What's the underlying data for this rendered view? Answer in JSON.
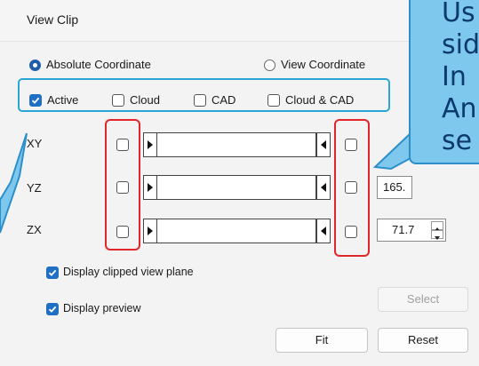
{
  "window": {
    "title": "View Clip"
  },
  "mode": {
    "absolute_label": "Absolute Coordinate",
    "view_label": "View Coordinate",
    "selected": "absolute"
  },
  "filters": {
    "active_label": "Active",
    "active_checked": true,
    "cloud_label": "Cloud",
    "cloud_checked": false,
    "cad_label": "CAD",
    "cad_checked": false,
    "cloud_cad_label": "Cloud & CAD",
    "cloud_cad_checked": false
  },
  "planes": [
    {
      "label": "XY",
      "value": ""
    },
    {
      "label": "YZ",
      "value": "165."
    },
    {
      "label": "ZX",
      "value": "71.7"
    }
  ],
  "options": {
    "display_clipped_label": "Display clipped view plane",
    "display_clipped_checked": true,
    "display_preview_label": "Display preview",
    "display_preview_checked": true
  },
  "buttons": {
    "select": "Select",
    "fit": "Fit",
    "reset": "Reset"
  },
  "callout": {
    "lines": [
      "Us",
      "sid",
      "In",
      "An",
      "se"
    ]
  },
  "colors": {
    "accent": "#1f6fc4",
    "highlight_blue": "#2aa6d6",
    "highlight_red": "#e0262a",
    "callout_fill": "#7ec8ee"
  }
}
